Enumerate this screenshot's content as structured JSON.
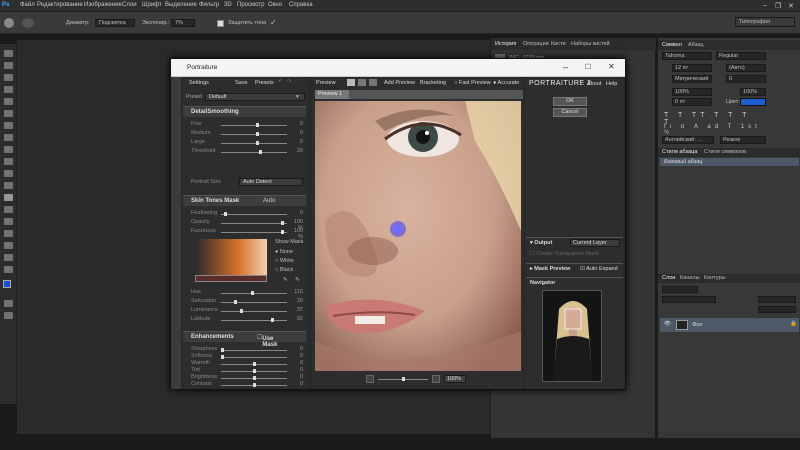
{
  "menu": [
    "Файл",
    "Редактирование",
    "Изображение",
    "Слои",
    "Шрифт",
    "Выделение",
    "Фильтр",
    "3D",
    "Просмотр",
    "Окно",
    "Справка"
  ],
  "options": {
    "size_label": "Диаметр:",
    "mode_label": "Подсветка",
    "exposure_label": "Экспонир.:",
    "exposure_value": "7%",
    "protect_label": "Защитить тона"
  },
  "workspace": "Типография",
  "doc_tab": "IMG_0768.jpg",
  "history_panel": {
    "tabs": [
      "История",
      "Операции",
      "Кисти",
      "Наборы кистей"
    ]
  },
  "char_panel": {
    "tabs": [
      "Символ",
      "Абзац"
    ],
    "font": "Tahoma",
    "style": "Regular",
    "size": "12 пт",
    "leading": "(Авто)",
    "kerning": "Метрический",
    "tracking": "0",
    "vscale": "100%",
    "hscale": "100%",
    "baseline": "0 пт",
    "color_label": "Цвет:",
    "lang": "Английский: ...",
    "aa": "Резкое"
  },
  "styles_panel": {
    "tabs": [
      "Стили абзаца",
      "Стили символов"
    ],
    "item": "Базовый абзац"
  },
  "layers_panel": {
    "tabs": [
      "Слои",
      "Каналы",
      "Контуры"
    ],
    "layer_name": "Фон"
  },
  "plugin": {
    "window_title": "Portraiture",
    "settings_label": "Settings",
    "save": "Save",
    "presets": "Presets",
    "preset_label": "Preset",
    "preset_value": "Default",
    "detail": {
      "title": "DetailSmoothing",
      "rows": [
        {
          "label": "Fine",
          "value": "0",
          "pos": 0.55
        },
        {
          "label": "Medium",
          "value": "0",
          "pos": 0.55
        },
        {
          "label": "Large",
          "value": "0",
          "pos": 0.55
        },
        {
          "label": "Threshold",
          "value": "20",
          "pos": 0.6
        }
      ],
      "portrait_size_label": "Portrait Size",
      "portrait_size_value": "Auto Detect"
    },
    "skin": {
      "title": "Skin Tones Mask",
      "mode": "Auto",
      "rows": [
        {
          "label": "Feathering",
          "value": "0",
          "unit": "",
          "pos": 0.05
        },
        {
          "label": "Opacity",
          "value": "100",
          "unit": "%",
          "pos": 0.95
        },
        {
          "label": "Fuzziness",
          "value": "100",
          "unit": "%",
          "pos": 0.95
        }
      ],
      "show_mask_label": "Show Mask",
      "show_mask_options": [
        "None",
        "White",
        "Black"
      ],
      "hue_rows": [
        {
          "label": "Hue",
          "value": "115",
          "unit": "",
          "pos": 0.48
        },
        {
          "label": "Saturation",
          "value": "20",
          "unit": "",
          "pos": 0.2
        },
        {
          "label": "Luminance",
          "value": "37",
          "unit": "",
          "pos": 0.3
        },
        {
          "label": "Latitude",
          "value": "82",
          "unit": "",
          "pos": 0.8
        }
      ]
    },
    "enh": {
      "title": "Enhancements",
      "use_mask": "Use Mask",
      "rows": [
        {
          "label": "Sharpness",
          "value": "0",
          "pos": 0.0
        },
        {
          "label": "Softness",
          "value": "0",
          "pos": 0.0
        },
        {
          "label": "Warmth",
          "value": "0",
          "pos": 0.5
        },
        {
          "label": "Tint",
          "value": "0",
          "pos": 0.5
        },
        {
          "label": "Brightness",
          "value": "0",
          "pos": 0.5
        },
        {
          "label": "Contrast",
          "value": "0",
          "pos": 0.5
        }
      ]
    },
    "preview": {
      "label": "Preview",
      "add_preview": "Add Preview",
      "bracketing": "Bracketing",
      "fast_preview": "Fast Preview",
      "accurate": "Accurate",
      "tab": "Preview 1",
      "zoom": "100%"
    },
    "right": {
      "brand": "PORTRAITURE 2",
      "about": "About",
      "help": "Help",
      "ok": "OK",
      "cancel": "Cancel",
      "output_label": "Output",
      "output_value": "Current Layer",
      "create_transparent": "Create Transparent Mask",
      "mask_preview": "Mask Preview",
      "auto_expand": "Auto Expand",
      "navigator": "Navigator"
    }
  },
  "colors": {
    "accent": "#1e5fd0",
    "dark": "#2a2a2a",
    "panel": "#3c3c3c"
  }
}
